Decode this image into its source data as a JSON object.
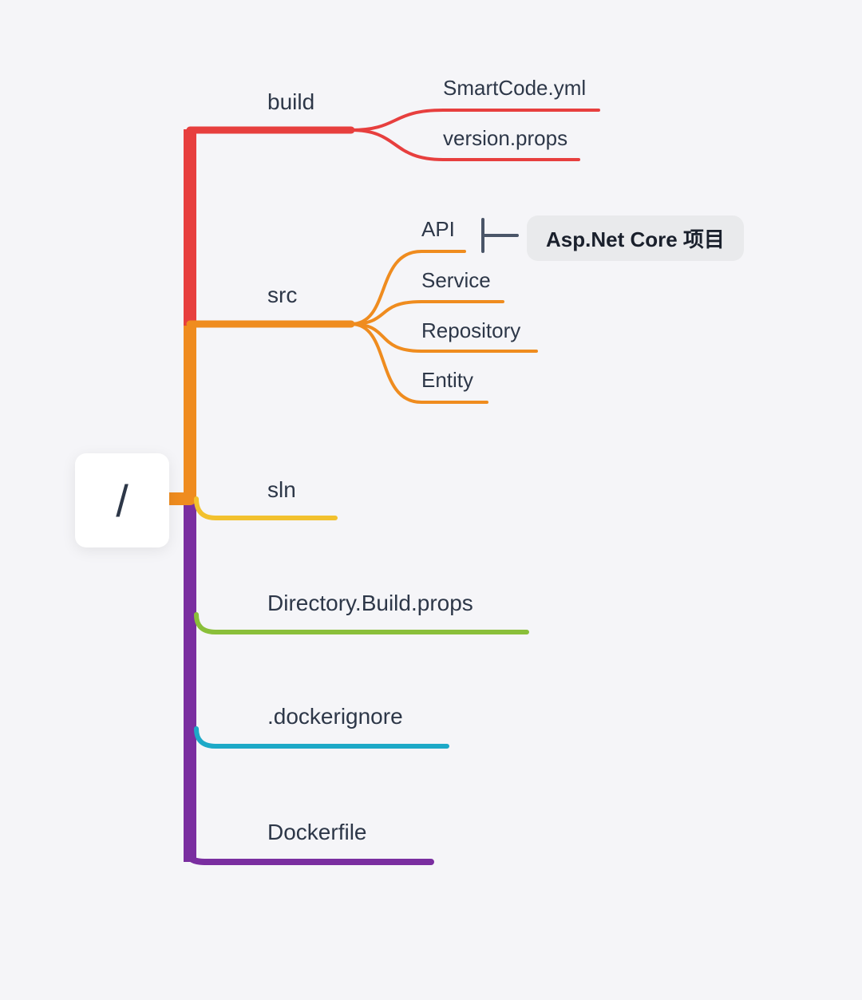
{
  "root": {
    "label": "/"
  },
  "nodes": {
    "build": {
      "label": "build"
    },
    "src": {
      "label": "src"
    },
    "sln": {
      "label": "sln"
    },
    "dirbuild": {
      "label": "Directory.Build.props"
    },
    "dockerignore": {
      "label": ".dockerignore"
    },
    "dockerfile": {
      "label": "Dockerfile"
    },
    "smartcode": {
      "label": "SmartCode.yml"
    },
    "versionprops": {
      "label": "version.props"
    },
    "api": {
      "label": "API"
    },
    "service": {
      "label": "Service"
    },
    "repository": {
      "label": "Repository"
    },
    "entity": {
      "label": "Entity"
    }
  },
  "badge": {
    "label": "Asp.Net Core 项目"
  },
  "colors": {
    "red": "#e73f3e",
    "orange": "#ef8c1f",
    "yellow": "#f2c12e",
    "green": "#8abf3a",
    "cyan": "#1da9c7",
    "purple": "#7a2ea0"
  }
}
